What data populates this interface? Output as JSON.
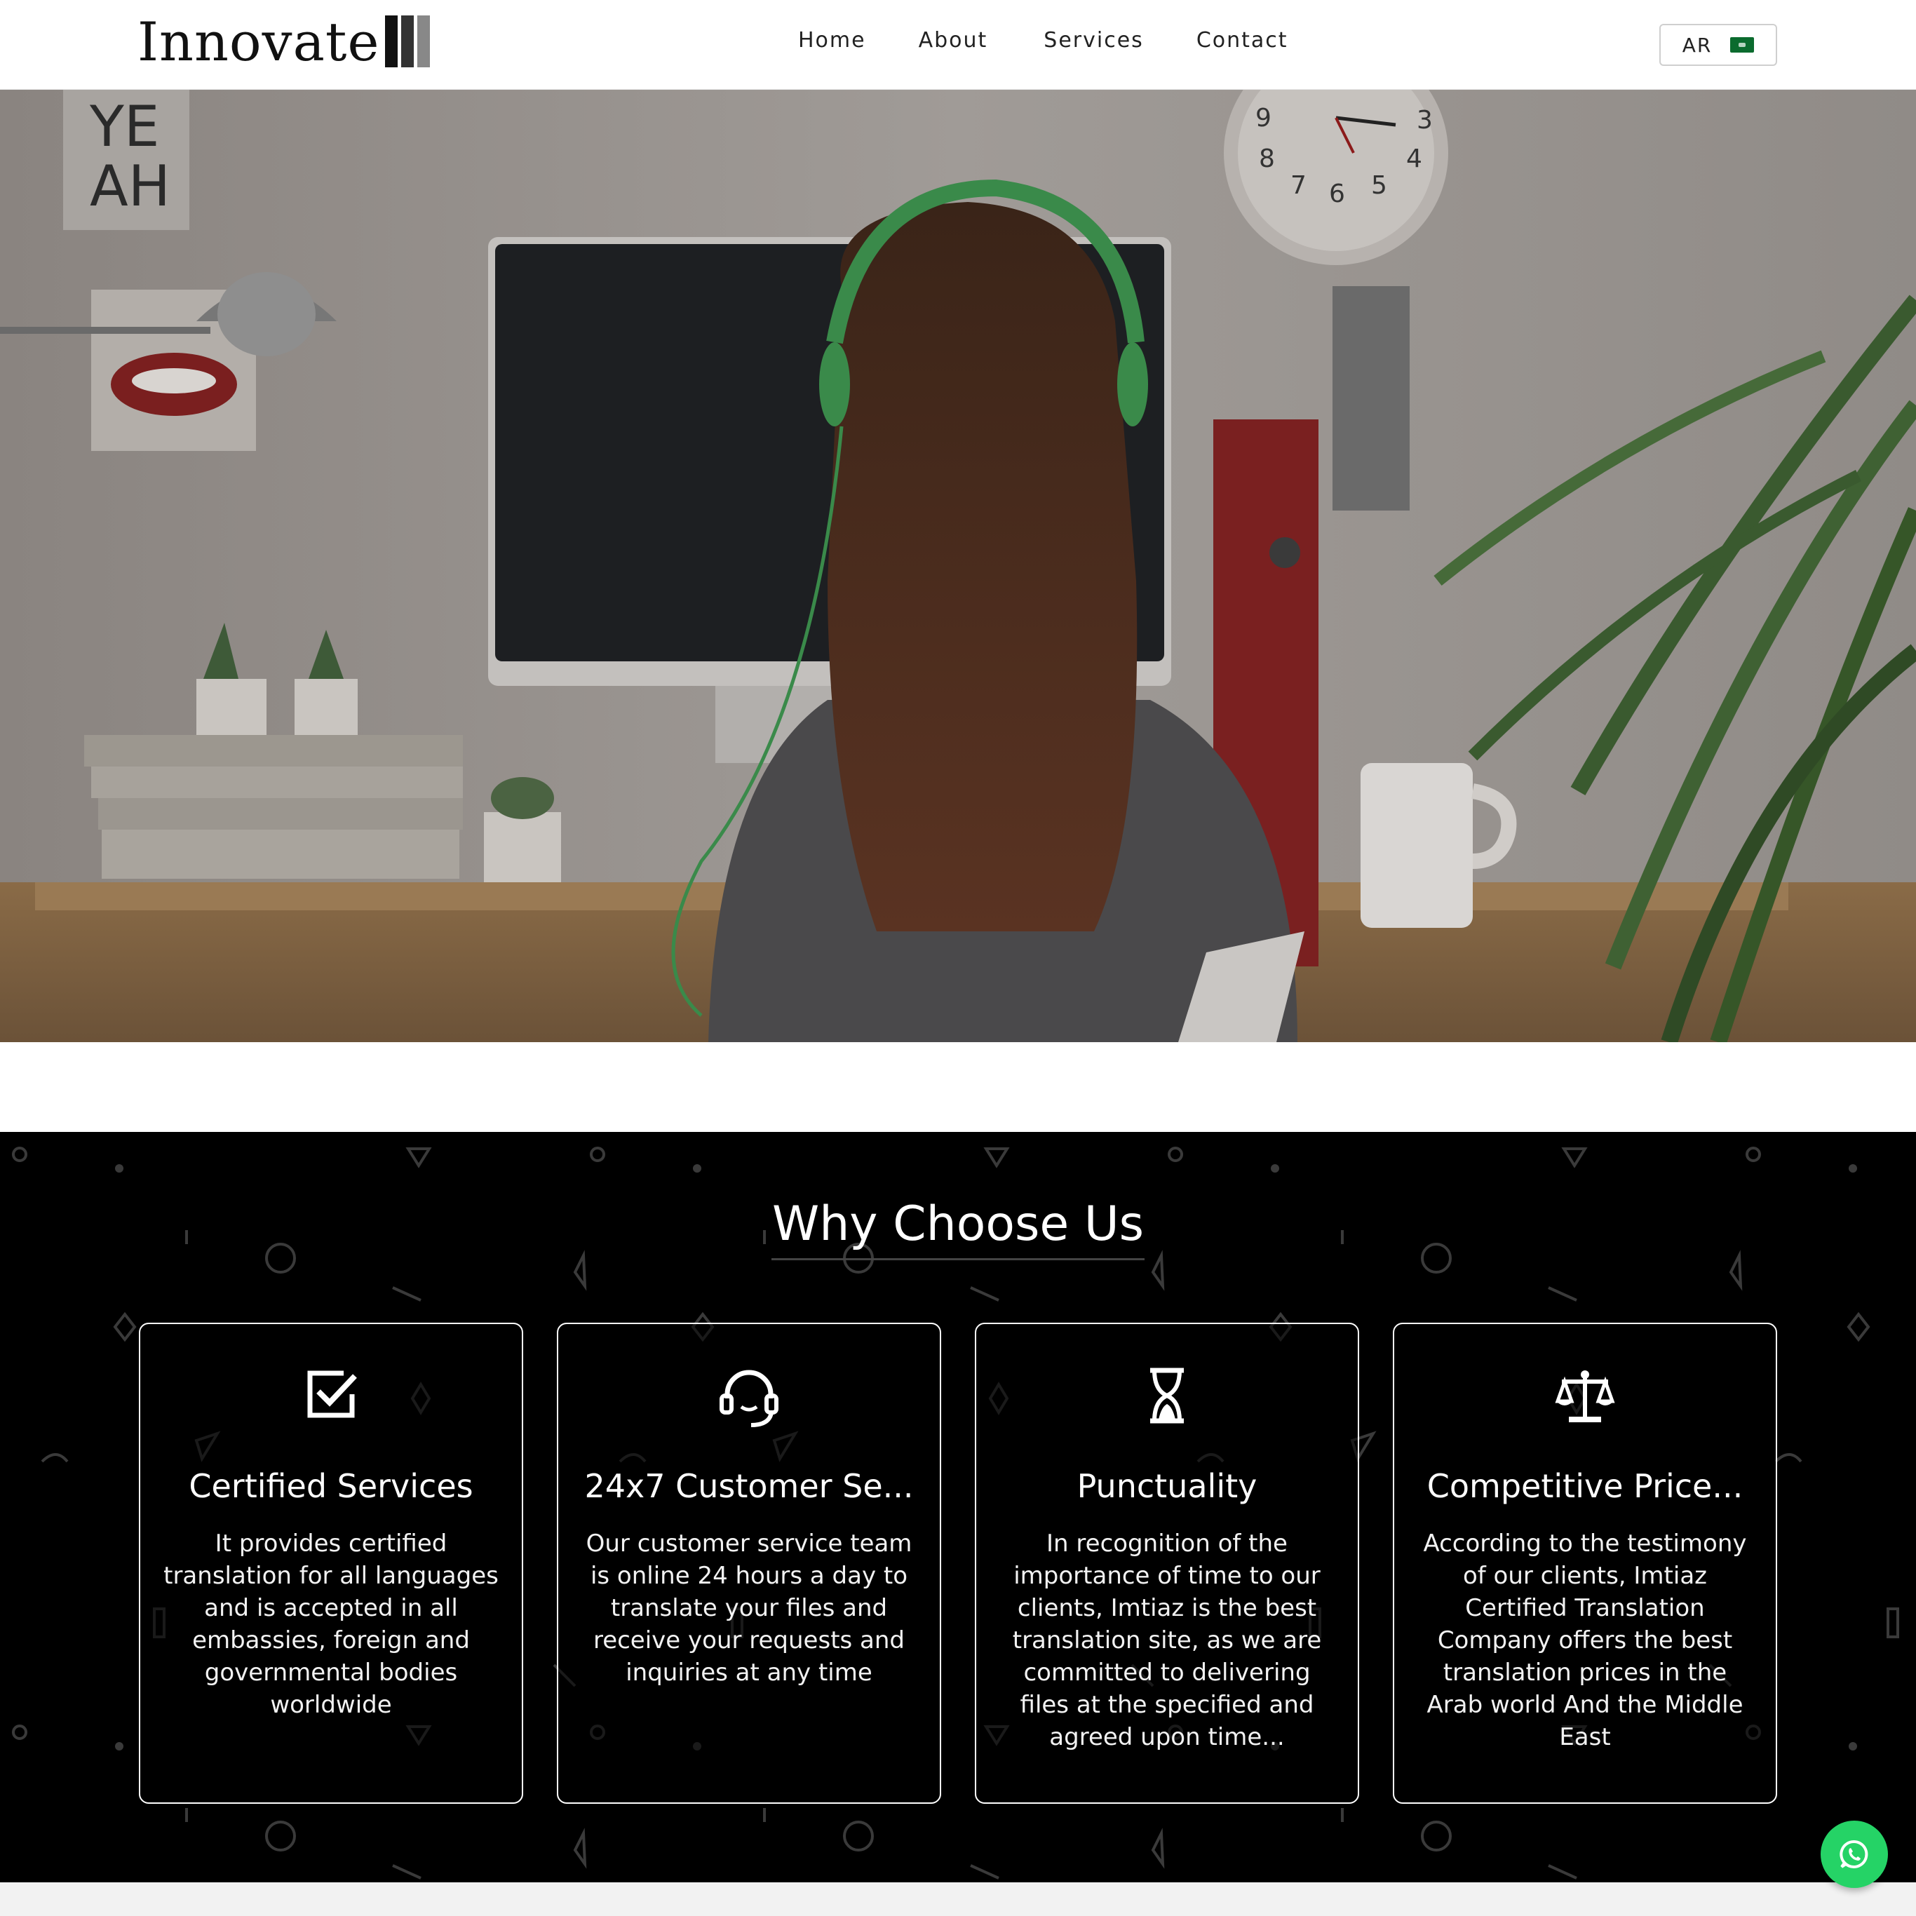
{
  "header": {
    "logo_text": "Innovate",
    "nav": [
      {
        "label": "Home"
      },
      {
        "label": "About"
      },
      {
        "label": "Services"
      },
      {
        "label": "Contact"
      }
    ],
    "lang_label": "AR",
    "lang_flag_icon": "saudi-flag-icon"
  },
  "hero": {
    "image": "woman-with-headphones-at-desk-photo"
  },
  "why": {
    "title": "Why Choose Us",
    "cards": [
      {
        "icon": "checkbox-icon",
        "title": "Certified Services",
        "text": "It provides certified translation for all languages and is accepted in all embassies, foreign and governmental bodies worldwide"
      },
      {
        "icon": "headset-icon",
        "title": "24x7 Customer Se...",
        "text": "Our customer service team is online 24 hours a day to translate your files and receive your requests and inquiries at any time"
      },
      {
        "icon": "hourglass-icon",
        "title": "Punctuality",
        "text": "In recognition of the importance of time to our clients, Imtiaz is the best translation site, as we are committed to delivering files at the specified and agreed upon time..."
      },
      {
        "icon": "scale-icon",
        "title": "Competitive Price...",
        "text": "According to the testimony of our clients, Imtiaz Certified Translation Company offers the best translation prices in the Arab world And the Middle East"
      }
    ]
  },
  "whatsapp_icon": "whatsapp-icon",
  "colors": {
    "whatsapp_green": "#25d366",
    "flag_green": "#0b6b2e",
    "section_bg": "#000000"
  }
}
